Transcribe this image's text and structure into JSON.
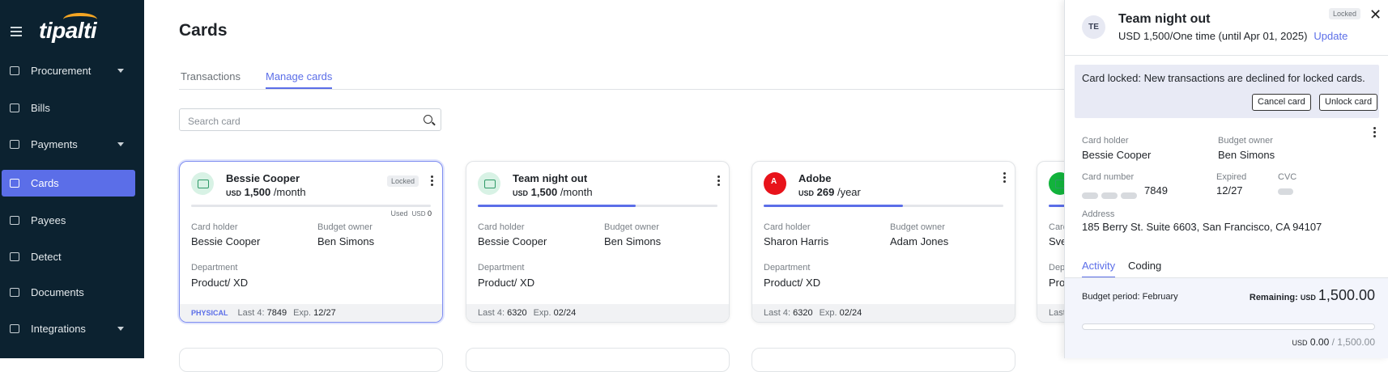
{
  "brand": {
    "name": "tipalti"
  },
  "sidebar": {
    "items": [
      {
        "label": "Procurement",
        "icon": "bag-icon",
        "chevron": true
      },
      {
        "label": "Bills",
        "icon": "bill-icon",
        "chevron": false
      },
      {
        "label": "Payments",
        "icon": "money-bag-icon",
        "chevron": true
      },
      {
        "label": "Cards",
        "icon": "card-icon",
        "chevron": false,
        "active": true
      },
      {
        "label": "Payees",
        "icon": "people-icon",
        "chevron": false
      },
      {
        "label": "Detect",
        "icon": "detect-icon",
        "chevron": false
      },
      {
        "label": "Documents",
        "icon": "document-icon",
        "chevron": false
      },
      {
        "label": "Integrations",
        "icon": "sync-icon",
        "chevron": true
      }
    ]
  },
  "main": {
    "title": "Cards",
    "tabs": [
      {
        "label": "Transactions"
      },
      {
        "label": "Manage cards",
        "active": true
      }
    ],
    "search": {
      "placeholder": "Search card"
    }
  },
  "cards": [
    {
      "name": "Bessie Cooper",
      "currency": "USD",
      "amount": "1,500",
      "period": "/month",
      "locked_label": "Locked",
      "used_label": "Used",
      "used_currency": "USD",
      "used_value": "0",
      "progress": 0,
      "holder_label": "Card holder",
      "holder": "Bessie Cooper",
      "owner_label": "Budget owner",
      "owner": "Ben Simons",
      "dept_label": "Department",
      "dept": "Product/ XD",
      "physical": "PHYSICAL",
      "last4_label": "Last 4:",
      "last4": "7849",
      "exp_label": "Exp.",
      "exp": "12/27"
    },
    {
      "name": "Team night out",
      "currency": "USD",
      "amount": "1,500",
      "period": "/month",
      "progress": 0.66,
      "holder_label": "Card holder",
      "holder": "Bessie Cooper",
      "owner_label": "Budget owner",
      "owner": "Ben Simons",
      "dept_label": "Department",
      "dept": "Product/ XD",
      "last4_label": "Last 4:",
      "last4": "6320",
      "exp_label": "Exp.",
      "exp": "02/24"
    },
    {
      "name": "Adobe",
      "currency": "USD",
      "amount": "269",
      "period": "/year",
      "progress": 0.58,
      "holder_label": "Card holder",
      "holder": "Sharon Harris",
      "owner_label": "Budget owner",
      "owner": "Adam Jones",
      "dept_label": "Department",
      "dept": "Product/ XD",
      "last4_label": "Last 4:",
      "last4": "6320",
      "exp_label": "Exp.",
      "exp": "02/24"
    },
    {
      "holder_label": "Card",
      "holder": "Sve",
      "dept_label": "Dep",
      "dept": "Pro",
      "last4_label": "Last"
    }
  ],
  "panel": {
    "initials": "TE",
    "title": "Team night out",
    "subtitle": "USD 1,500/One time (until Apr 01, 2025)",
    "update_label": "Update",
    "locked_label": "Locked",
    "banner_msg": "Card locked: New transactions are declined for locked cards.",
    "cancel_label": "Cancel card",
    "unlock_label": "Unlock card",
    "holder_label": "Card holder",
    "holder": "Bessie Cooper",
    "owner_label": "Budget owner",
    "owner": "Ben Simons",
    "number_label": "Card number",
    "number_last": "7849",
    "expired_label": "Expired",
    "expired": "12/27",
    "cvc_label": "CVC",
    "address_label": "Address",
    "address": "185 Berry St. Suite 6603, San Francisco, CA 94107",
    "tabs": [
      {
        "label": "Activity",
        "active": true
      },
      {
        "label": "Coding"
      }
    ],
    "budget_period": "Budget period: February",
    "remaining_label": "Remaining:",
    "remaining_currency": "USD",
    "remaining": "1,500.00",
    "spent_currency": "USD",
    "spent": "0.00",
    "total": "/ 1,500.00",
    "spent_progress": 0
  }
}
